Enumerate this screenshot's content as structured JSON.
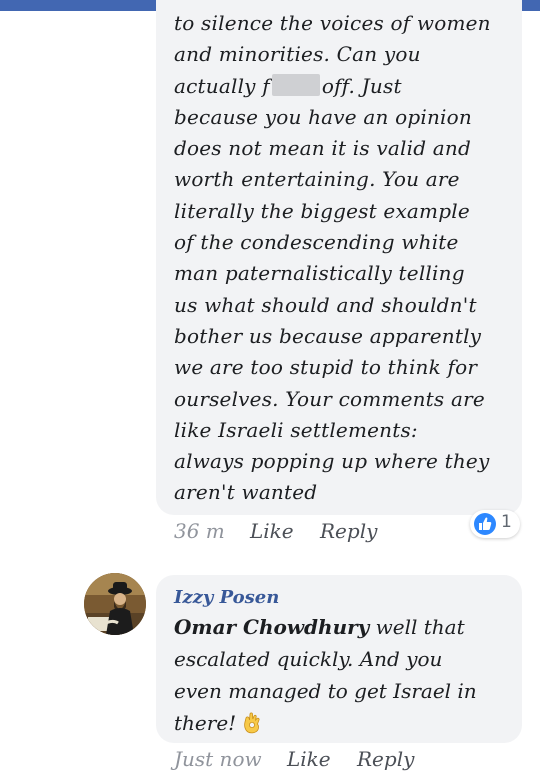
{
  "comment1": {
    "lines": [
      "to silence the voices of women",
      "and minorities. Can you",
      "off. Just",
      "because you have an opinion",
      "does not mean it is valid and",
      "worth entertaining. You are",
      "literally the biggest example",
      "of the condescending white",
      "man paternalistically telling",
      "us what should and shouldn't",
      "bother us because apparently",
      "we are too stupid to think for",
      "ourselves. Your comments are",
      "like Israeli settlements:",
      "always popping up where they",
      "aren't wanted"
    ],
    "line3_prefix": "actually f",
    "timestamp": "36 m",
    "like_label": "Like",
    "reply_label": "Reply",
    "reaction_icon": "like-thumb-icon",
    "reaction_count": "1"
  },
  "comment2": {
    "author": "Izzy Posen",
    "mention": "Omar Chowdhury",
    "text_after_mention": " well that",
    "lines": [
      "escalated quickly. And you",
      "even managed to get Israel in",
      "there!"
    ],
    "emoji": "ok-hand-icon",
    "timestamp": "Just now",
    "like_label": "Like",
    "reply_label": "Reply"
  },
  "colors": {
    "brand": "#4267b2",
    "bubble": "#f2f3f5",
    "like_blue": "#2d88ff",
    "name_link": "#385898",
    "meta": "#90949c"
  }
}
